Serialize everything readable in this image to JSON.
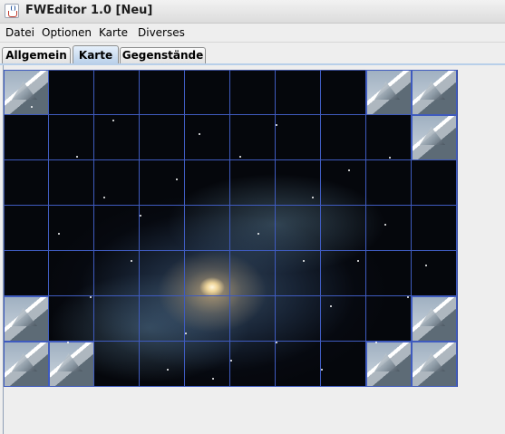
{
  "window": {
    "title": "FWEditor 1.0 [Neu]"
  },
  "menubar": {
    "items": [
      "Datei",
      "Optionen",
      "Karte",
      "Diverses"
    ]
  },
  "tabs": [
    {
      "label": "Allgemein",
      "selected": false
    },
    {
      "label": "Karte",
      "selected": true
    },
    {
      "label": "Gegenstände",
      "selected": false
    }
  ],
  "map": {
    "columns": 10,
    "rows": 7,
    "tiles": [
      [
        "mountain",
        "space",
        "space",
        "space",
        "space",
        "space",
        "space",
        "space",
        "mountain",
        "mountain"
      ],
      [
        "space",
        "space",
        "space",
        "space",
        "space",
        "space",
        "space",
        "space",
        "space",
        "mountain"
      ],
      [
        "space",
        "space",
        "space",
        "space",
        "space",
        "space",
        "space",
        "space",
        "space",
        "space"
      ],
      [
        "space",
        "space",
        "space",
        "space",
        "space",
        "space",
        "space",
        "space",
        "space",
        "space"
      ],
      [
        "space",
        "space",
        "space",
        "space",
        "space",
        "space",
        "space",
        "space",
        "space",
        "space"
      ],
      [
        "mountain",
        "space",
        "space",
        "space",
        "space",
        "space",
        "space",
        "space",
        "space",
        "mountain"
      ],
      [
        "mountain",
        "mountain",
        "space",
        "space",
        "space",
        "space",
        "space",
        "space",
        "mountain",
        "mountain"
      ]
    ]
  },
  "colors": {
    "grid_line": "#3f5bbf",
    "selected_tab": "#b8cfe9"
  },
  "icons": {
    "app": "java-cup-icon"
  }
}
